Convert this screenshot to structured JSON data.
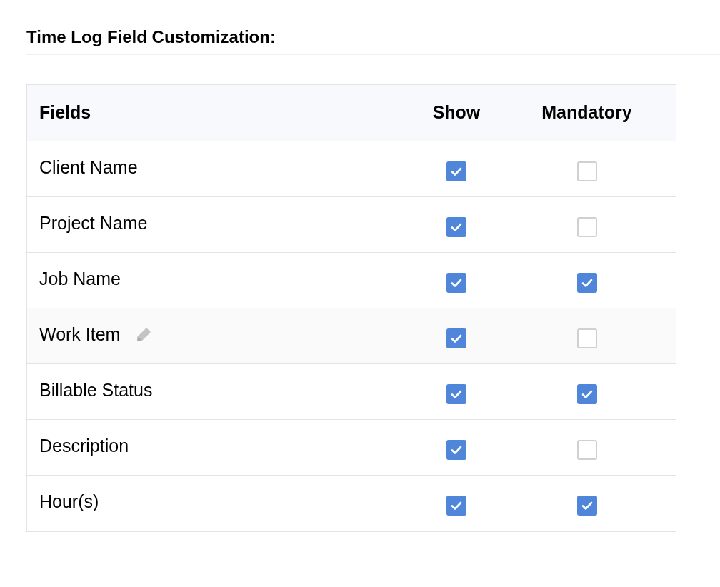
{
  "title": "Time Log Field Customization:",
  "table": {
    "columns": [
      "Fields",
      "Show",
      "Mandatory"
    ],
    "rows": [
      {
        "field": "Client Name",
        "show": true,
        "mandatory": false,
        "highlighted": false,
        "editable": false
      },
      {
        "field": "Project Name",
        "show": true,
        "mandatory": false,
        "highlighted": false,
        "editable": false
      },
      {
        "field": "Job Name",
        "show": true,
        "mandatory": true,
        "highlighted": false,
        "editable": false
      },
      {
        "field": "Work Item",
        "show": true,
        "mandatory": false,
        "highlighted": true,
        "editable": true
      },
      {
        "field": "Billable Status",
        "show": true,
        "mandatory": true,
        "highlighted": false,
        "editable": false
      },
      {
        "field": "Description",
        "show": true,
        "mandatory": false,
        "highlighted": false,
        "editable": false
      },
      {
        "field": "Hour(s)",
        "show": true,
        "mandatory": true,
        "highlighted": false,
        "editable": false
      }
    ]
  }
}
